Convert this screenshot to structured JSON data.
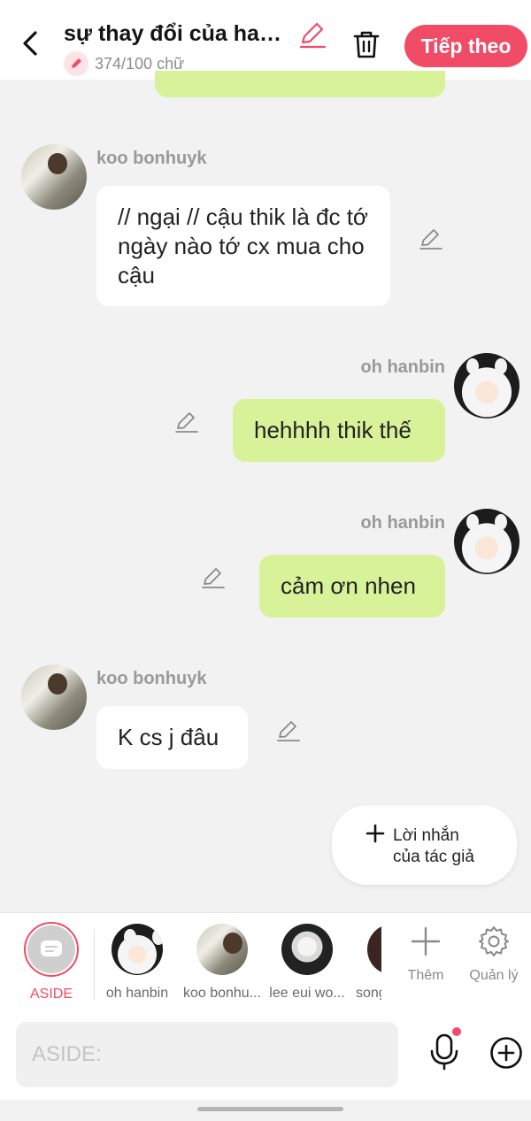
{
  "header": {
    "title": "sự thay đổi của hanbin",
    "word_count": "374/100 chữ",
    "next_label": "Tiếp theo",
    "accent": "#f04c67"
  },
  "messages": [
    {
      "side": "left",
      "sender": "koo bonhuyk",
      "text": "// ngại // cậu thik là đc tớ ngày nào tớ cx mua cho cậu"
    },
    {
      "side": "right",
      "sender": "oh hanbin",
      "text": "hehhhh thik thế"
    },
    {
      "side": "right",
      "sender": "oh hanbin",
      "text": "cảm ơn nhen"
    },
    {
      "side": "left",
      "sender": "koo bonhuyk",
      "text": "K cs j đâu"
    }
  ],
  "author_note": {
    "line1": "Lời nhắn",
    "line2": "của tác giả"
  },
  "characters": {
    "aside": "ASIDE",
    "items": [
      "oh hanbin",
      "koo bonhu...",
      "lee eui wo...",
      "song"
    ],
    "add_label": "Thêm",
    "manage_label": "Quản lý"
  },
  "input": {
    "placeholder": "ASIDE:",
    "value": ""
  },
  "colors": {
    "bubble_right": "#d8f29a",
    "bubble_left": "#ffffff",
    "background": "#f2f2f2"
  }
}
